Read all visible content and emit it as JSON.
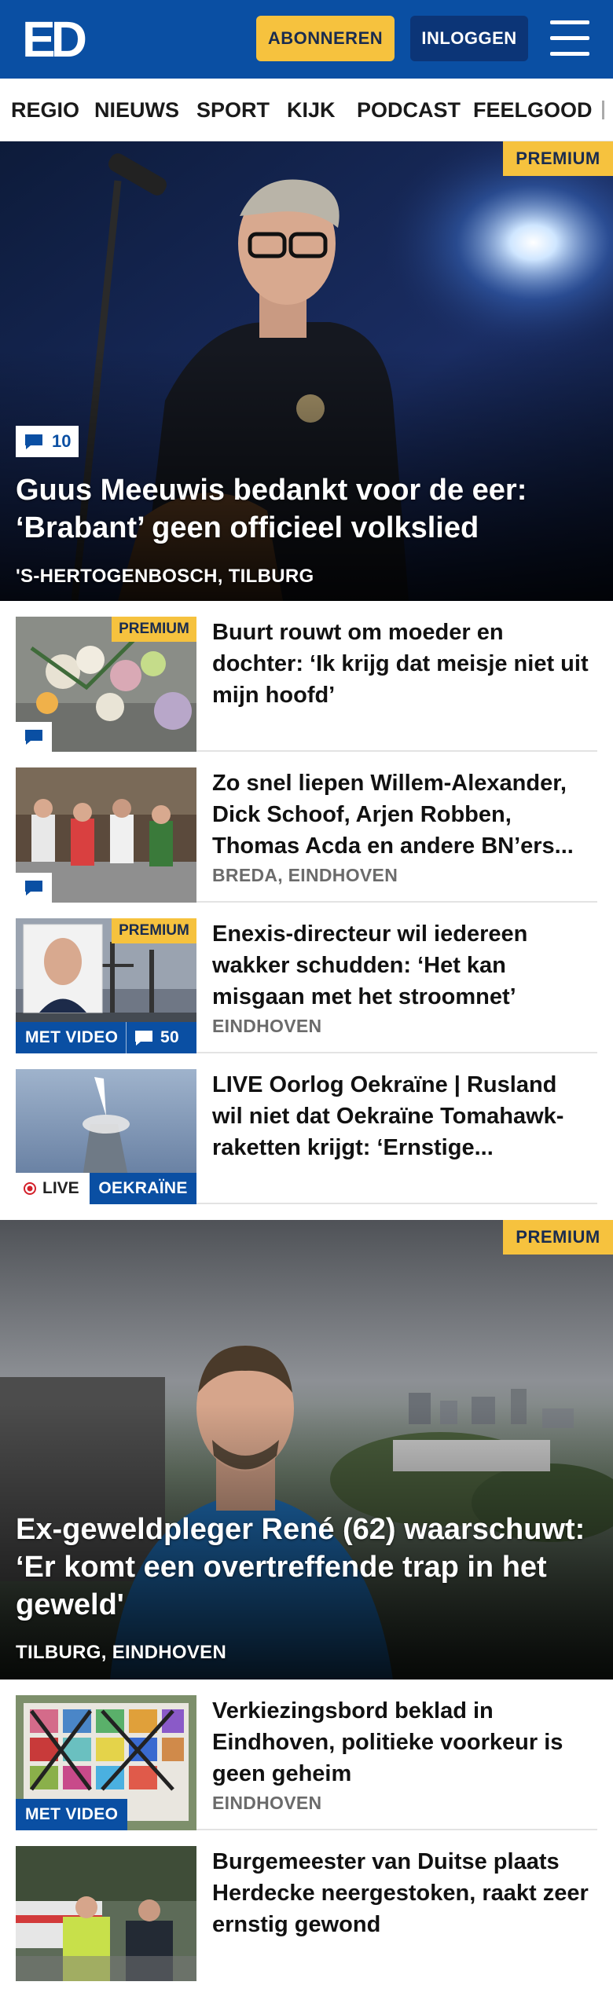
{
  "header": {
    "logo": "ED",
    "subscribe_label": "ABONNEREN",
    "login_label": "INLOGGEN",
    "brand_color": "#0a4fa3",
    "accent_color": "#f6c23e"
  },
  "nav": {
    "items": [
      "REGIO",
      "NIEUWS",
      "SPORT",
      "KIJK",
      "PODCAST",
      "FEELGOOD"
    ]
  },
  "hero1": {
    "premium": "PREMIUM",
    "comments": "10",
    "title": "Guus Meeuwis bedankt voor de eer: ‘Brabant’ geen officieel volkslied",
    "location": "'S-HERTOGENBOSCH, TILBURG"
  },
  "articles": [
    {
      "premium": "PREMIUM",
      "title": "Buurt rouwt om moeder en dochter: ‘Ik krijg dat meisje niet uit mijn hoofd’",
      "location": ""
    },
    {
      "title": "Zo snel liepen Willem-Alexander, Dick Schoof, Arjen Robben, Thomas Acda en andere BN’ers...",
      "location": "BREDA, EINDHOVEN"
    },
    {
      "premium": "PREMIUM",
      "title": "Enexis-directeur wil iedereen wakker schudden: ‘Het kan misgaan met het stroomnet’",
      "location": "EINDHOVEN",
      "video_label": "MET VIDEO",
      "comments": "50"
    },
    {
      "title": "LIVE Oorlog Oekraïne | Rusland wil niet dat Oekraïne Tomahawk-raketten krijgt: ‘Ernstige...",
      "live_label": "LIVE",
      "tag_label": "OEKRAÏNE"
    }
  ],
  "hero2": {
    "premium": "PREMIUM",
    "title": "Ex-geweldpleger René (62) waarschuwt: ‘Er komt een overtref­fende trap in het geweld'",
    "location": "TILBURG, EINDHOVEN"
  },
  "articles2": [
    {
      "title": "Verkiezingsbord beklad in Eindhoven, politieke voorkeur is geen geheim",
      "location": "EINDHOVEN",
      "video_label": "MET VIDEO"
    },
    {
      "title": "Burgemeester van Duitse plaats Herdecke neergestoken, raakt zeer ernstig gewond",
      "location": ""
    }
  ]
}
